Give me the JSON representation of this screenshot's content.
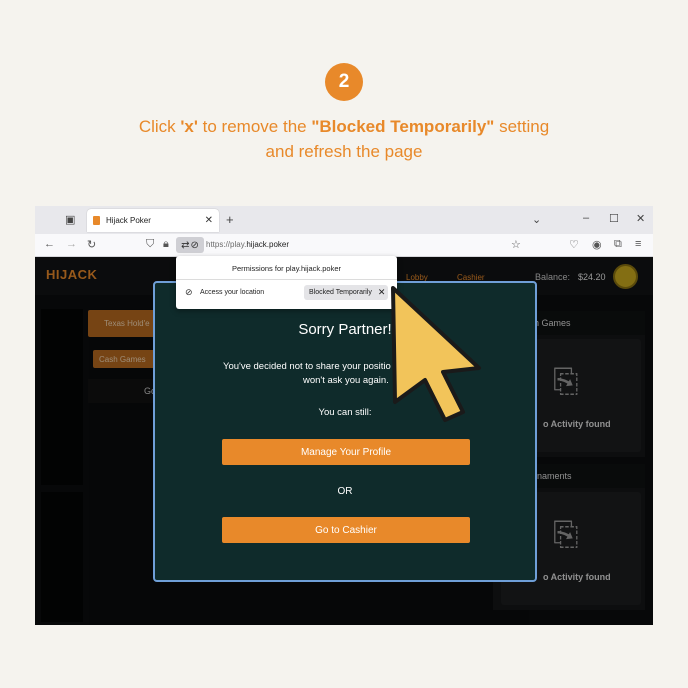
{
  "step": {
    "number": "2"
  },
  "instruction": {
    "p1": "Click ",
    "x_key": "'x'",
    "p2": " to remove the ",
    "setting": "\"Blocked Temporarily\"",
    "p3": " setting",
    "line2": "and refresh the page"
  },
  "browser": {
    "tab_title": "Hijack Poker",
    "tab_close": "✕",
    "new_tab": "+",
    "url_prefix": "https://play.",
    "url_domain": "hijack.poker",
    "window_min": "–",
    "window_max": "☐",
    "window_close": "✕"
  },
  "site": {
    "logo": "HIJACK",
    "nav": [
      "Lobby",
      "Cashier"
    ],
    "balance_label": "Balance:",
    "balance_value": "$24.20",
    "left_chips": [
      "Texas Hold'e",
      "Cash Games",
      "Go"
    ],
    "right_cards": [
      {
        "title": "h Games",
        "empty": "o Activity found"
      },
      {
        "title": "rnaments",
        "empty": "o Activity found"
      }
    ]
  },
  "modal": {
    "title": "Sorry Partner!",
    "msg_line1": "You've decided not to share your positio",
    "msg_line2": "won't ask you again.",
    "can_still": "You can still:",
    "btn_profile": "Manage Your Profile",
    "or_text": "OR",
    "btn_cashier": "Go to Cashier"
  },
  "permissions_popup": {
    "title": "Permissions for play.hijack.poker",
    "row_label": "Access your location",
    "chip_text": "Blocked Temporarily",
    "chip_close": "✕"
  },
  "colors": {
    "accent": "#e8892a",
    "modal_bg": "#0f2b2b",
    "modal_border": "#6f9fd8",
    "cursor_fill": "#f2c45a"
  }
}
